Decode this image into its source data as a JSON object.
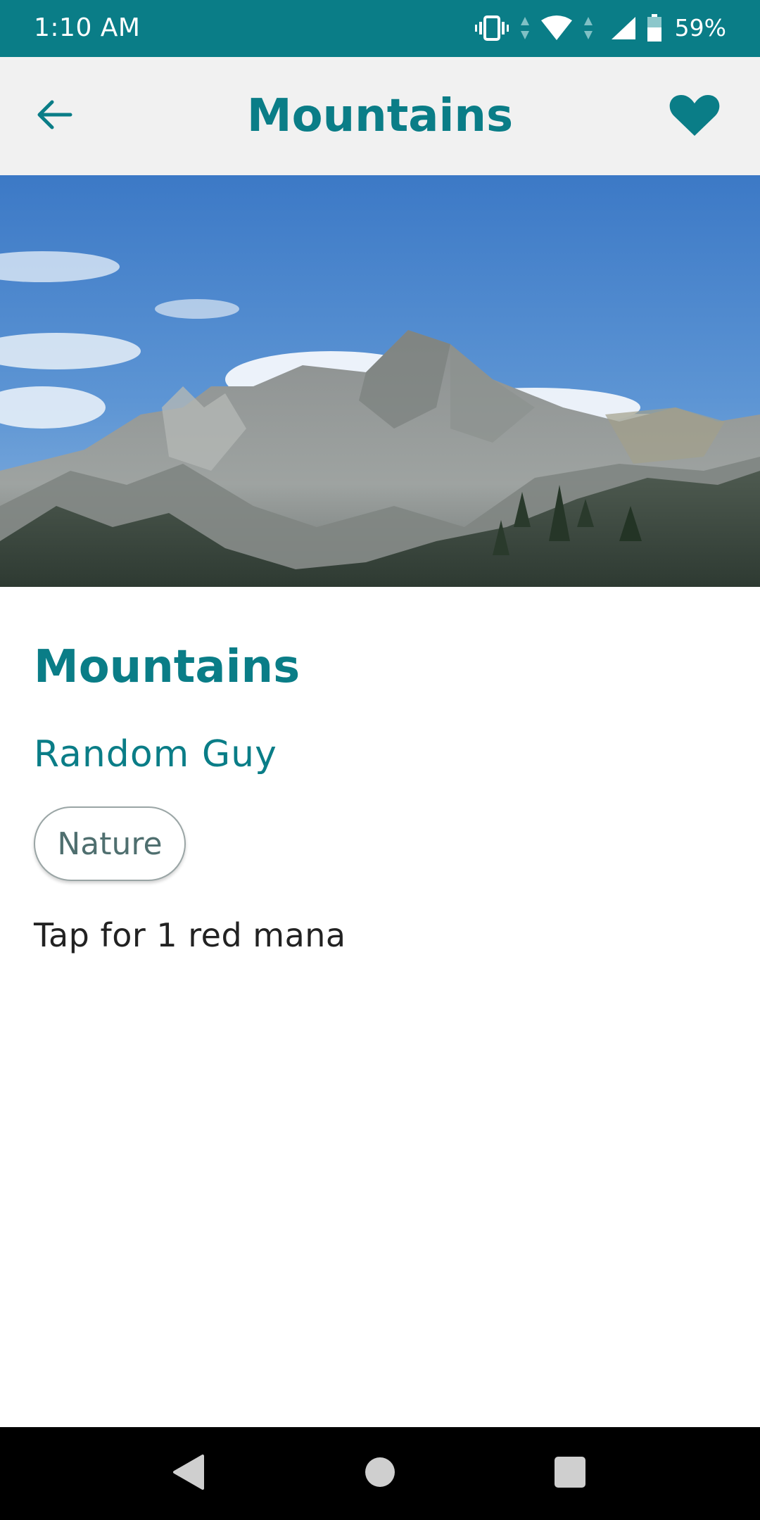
{
  "status_bar": {
    "time": "1:10 AM",
    "battery_percent": "59%",
    "icons": [
      "vibrate-icon",
      "wifi-icon",
      "signal-icon",
      "battery-icon"
    ],
    "background_color": "#0a7d87"
  },
  "app_bar": {
    "title": "Mountains",
    "back_icon": "arrow-left-icon",
    "favorite_icon": "heart-icon",
    "accent_color": "#0a7d87"
  },
  "hero": {
    "subject": "mountain-landscape"
  },
  "content": {
    "title": "Mountains",
    "author": "Random Guy",
    "tag": "Nature",
    "description": "Tap for 1 red mana"
  },
  "nav_bar": {
    "icons": [
      "nav-back-icon",
      "nav-home-icon",
      "nav-recents-icon"
    ]
  }
}
